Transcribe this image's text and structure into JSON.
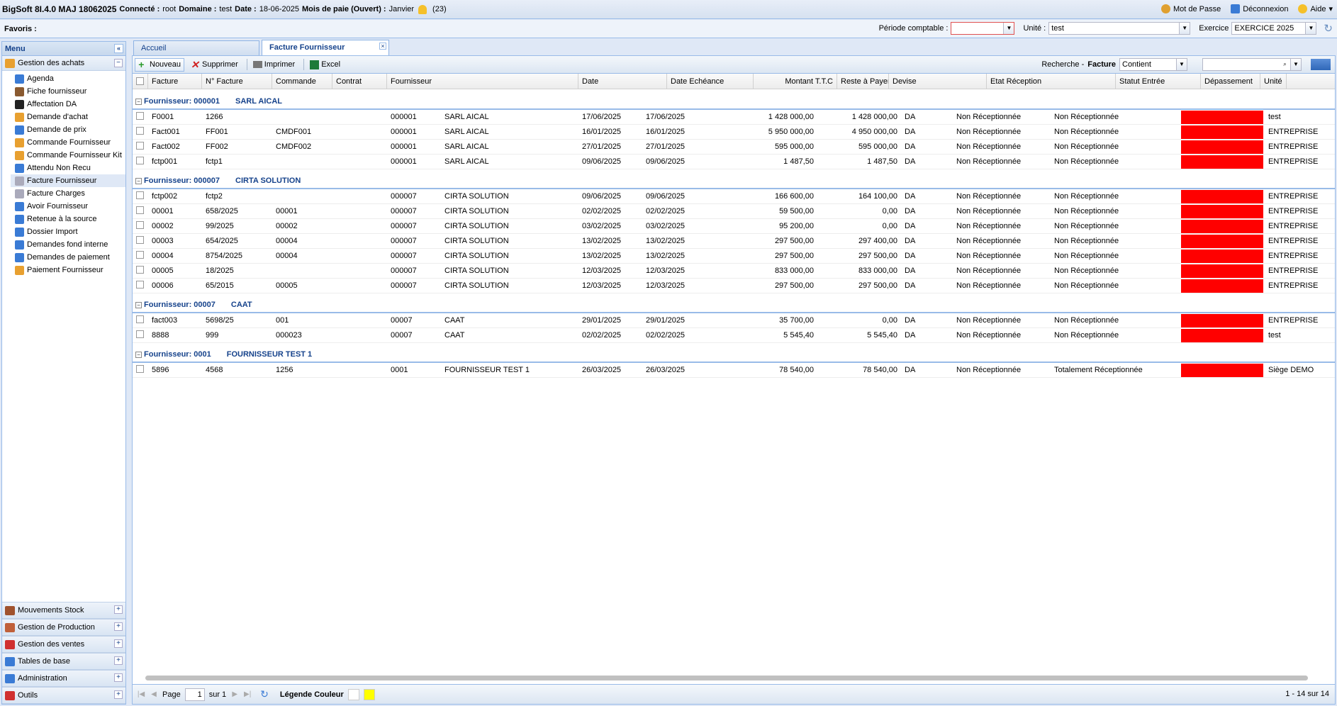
{
  "header": {
    "app": "BigSoft 8I.4.0 MAJ 18062025",
    "connecte_label": "Connecté :",
    "connecte": "root",
    "domaine_label": "Domaine :",
    "domaine": "test",
    "date_label": "Date :",
    "date": "18-06-2025",
    "mois_label": "Mois de paie (Ouvert) :",
    "mois": "Janvier",
    "notif": "(23)",
    "mot_de_passe": "Mot de Passe",
    "deconnexion": "Déconnexion",
    "aide": "Aide"
  },
  "favbar": {
    "label": "Favoris :",
    "periode_label": "Période comptable :",
    "periode_value": "",
    "unite_label": "Unité :",
    "unite_value": "test",
    "exercice_label": "Exercice",
    "exercice_value": "EXERCICE 2025"
  },
  "sidebar": {
    "title": "Menu",
    "group_open": "Gestion des achats",
    "items": [
      "Agenda",
      "Fiche fournisseur",
      "Affectation DA",
      "Demande d'achat",
      "Demande de prix",
      "Commande Fournisseur",
      "Commande Fournisseur Kit",
      "Attendu Non Recu",
      "Facture Fournisseur",
      "Facture Charges",
      "Avoir Fournisseur",
      "Retenue à la source",
      "Dossier Import",
      "Demandes fond interne",
      "Demandes de paiement",
      "Paiement Fournisseur"
    ],
    "bottom_groups": [
      "Mouvements Stock",
      "Gestion de Production",
      "Gestion des ventes",
      "Tables de base",
      "Administration",
      "Outils"
    ]
  },
  "tabs": {
    "home": "Accueil",
    "active": "Facture Fournisseur"
  },
  "toolbar": {
    "nouveau": "Nouveau",
    "supprimer": "Supprimer",
    "imprimer": "Imprimer",
    "excel": "Excel",
    "recherche": "Recherche -",
    "field": "Facture",
    "op": "Contient",
    "search_value": ""
  },
  "columns": [
    "Facture",
    "N° Facture",
    "Commande",
    "Contrat",
    "Fournisseur",
    "Date",
    "Date Echéance",
    "Montant T.T.C",
    "Reste à Payer",
    "Devise",
    "Etat Réception",
    "Statut Entrée",
    "Dépassement",
    "Unité"
  ],
  "groups": [
    {
      "label": "Fournisseur: 000001",
      "name": "SARL AICAL",
      "rows": [
        [
          "F0001",
          "1266",
          "",
          "",
          "000001",
          "SARL AICAL",
          "17/06/2025",
          "17/06/2025",
          "1 428 000,00",
          "1 428 000,00",
          "DA",
          "Non Réceptionnée",
          "Non Réceptionnée",
          "test"
        ],
        [
          "Fact001",
          "FF001",
          "CMDF001",
          "",
          "000001",
          "SARL AICAL",
          "16/01/2025",
          "16/01/2025",
          "5 950 000,00",
          "4 950 000,00",
          "DA",
          "Non Réceptionnée",
          "Non Réceptionnée",
          "ENTREPRISE"
        ],
        [
          "Fact002",
          "FF002",
          "CMDF002",
          "",
          "000001",
          "SARL AICAL",
          "27/01/2025",
          "27/01/2025",
          "595 000,00",
          "595 000,00",
          "DA",
          "Non Réceptionnée",
          "Non Réceptionnée",
          "ENTREPRISE"
        ],
        [
          "fctp001",
          "fctp1",
          "",
          "",
          "000001",
          "SARL AICAL",
          "09/06/2025",
          "09/06/2025",
          "1 487,50",
          "1 487,50",
          "DA",
          "Non Réceptionnée",
          "Non Réceptionnée",
          "ENTREPRISE"
        ]
      ]
    },
    {
      "label": "Fournisseur: 000007",
      "name": "CIRTA SOLUTION",
      "rows": [
        [
          "fctp002",
          "fctp2",
          "",
          "",
          "000007",
          "CIRTA SOLUTION",
          "09/06/2025",
          "09/06/2025",
          "166 600,00",
          "164 100,00",
          "DA",
          "Non Réceptionnée",
          "Non Réceptionnée",
          "ENTREPRISE"
        ],
        [
          "00001",
          "658/2025",
          "00001",
          "",
          "000007",
          "CIRTA SOLUTION",
          "02/02/2025",
          "02/02/2025",
          "59 500,00",
          "0,00",
          "DA",
          "Non Réceptionnée",
          "Non Réceptionnée",
          "ENTREPRISE"
        ],
        [
          "00002",
          "99/2025",
          "00002",
          "",
          "000007",
          "CIRTA SOLUTION",
          "03/02/2025",
          "03/02/2025",
          "95 200,00",
          "0,00",
          "DA",
          "Non Réceptionnée",
          "Non Réceptionnée",
          "ENTREPRISE"
        ],
        [
          "00003",
          "654/2025",
          "00004",
          "",
          "000007",
          "CIRTA SOLUTION",
          "13/02/2025",
          "13/02/2025",
          "297 500,00",
          "297 400,00",
          "DA",
          "Non Réceptionnée",
          "Non Réceptionnée",
          "ENTREPRISE"
        ],
        [
          "00004",
          "8754/2025",
          "00004",
          "",
          "000007",
          "CIRTA SOLUTION",
          "13/02/2025",
          "13/02/2025",
          "297 500,00",
          "297 500,00",
          "DA",
          "Non Réceptionnée",
          "Non Réceptionnée",
          "ENTREPRISE"
        ],
        [
          "00005",
          "18/2025",
          "",
          "",
          "000007",
          "CIRTA SOLUTION",
          "12/03/2025",
          "12/03/2025",
          "833 000,00",
          "833 000,00",
          "DA",
          "Non Réceptionnée",
          "Non Réceptionnée",
          "ENTREPRISE"
        ],
        [
          "00006",
          "65/2015",
          "00005",
          "",
          "000007",
          "CIRTA SOLUTION",
          "12/03/2025",
          "12/03/2025",
          "297 500,00",
          "297 500,00",
          "DA",
          "Non Réceptionnée",
          "Non Réceptionnée",
          "ENTREPRISE"
        ]
      ]
    },
    {
      "label": "Fournisseur: 00007",
      "name": "CAAT",
      "rows": [
        [
          "fact003",
          "5698/25",
          "001",
          "",
          "00007",
          "CAAT",
          "29/01/2025",
          "29/01/2025",
          "35 700,00",
          "0,00",
          "DA",
          "Non Réceptionnée",
          "Non Réceptionnée",
          "ENTREPRISE"
        ],
        [
          "8888",
          "999",
          "000023",
          "",
          "00007",
          "CAAT",
          "02/02/2025",
          "02/02/2025",
          "5 545,40",
          "5 545,40",
          "DA",
          "Non Réceptionnée",
          "Non Réceptionnée",
          "test"
        ]
      ]
    },
    {
      "label": "Fournisseur: 0001",
      "name": "FOURNISSEUR TEST 1",
      "rows": [
        [
          "5896",
          "4568",
          "1256",
          "",
          "0001",
          "FOURNISSEUR TEST 1",
          "26/03/2025",
          "26/03/2025",
          "78 540,00",
          "78 540,00",
          "DA",
          "Non Réceptionnée",
          "Totalement Réceptionnée",
          "Siège DEMO"
        ]
      ]
    }
  ],
  "pager": {
    "page_label": "Page",
    "page": "1",
    "of": "sur 1",
    "legend": "Légende Couleur",
    "count": "1 - 14 sur 14"
  },
  "colors": {
    "overdue": "#ff0000",
    "accent": "#15428b"
  }
}
